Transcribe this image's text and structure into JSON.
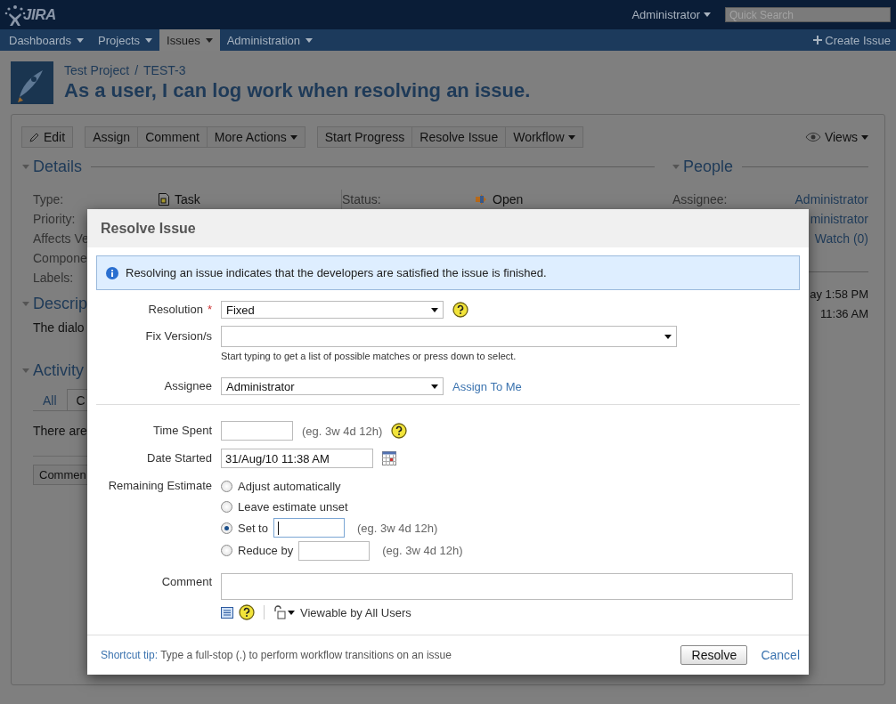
{
  "header": {
    "logo": "JIRA",
    "user": "Administrator",
    "search": {
      "placeholder": "Quick Search"
    }
  },
  "nav": {
    "items": [
      {
        "label": "Dashboards",
        "selected": false
      },
      {
        "label": "Projects",
        "selected": false
      },
      {
        "label": "Issues",
        "selected": true
      },
      {
        "label": "Administration",
        "selected": false
      }
    ],
    "create": "Create Issue"
  },
  "issue": {
    "project": "Test Project",
    "separator": "/",
    "key": "TEST-3",
    "title": "As a user, I can log work when resolving an issue."
  },
  "toolbar": {
    "groups": [
      [
        {
          "label": "Edit",
          "kind": "icon"
        }
      ],
      [
        {
          "label": "Assign",
          "kind": "plain"
        },
        {
          "label": "Comment",
          "kind": "plain"
        },
        {
          "label": "More Actions",
          "kind": "menu"
        }
      ],
      [
        {
          "label": "Start Progress",
          "kind": "plain"
        },
        {
          "label": "Resolve Issue",
          "kind": "plain"
        },
        {
          "label": "Workflow",
          "kind": "menu"
        }
      ]
    ],
    "views": "Views"
  },
  "details": {
    "heading": "Details",
    "rows": [
      {
        "label": "Type:",
        "value": "Task",
        "status_label": "Status:",
        "status_value": "Open"
      },
      {
        "label": "Priority:"
      },
      {
        "label": "Affects Ve"
      },
      {
        "label": "Compone"
      },
      {
        "label": "Labels:"
      }
    ]
  },
  "description": {
    "heading": "Descrip",
    "text": "The dialo"
  },
  "activity": {
    "heading": "Activity",
    "tabs": [
      {
        "label": "All",
        "selected": false
      },
      {
        "label": "C",
        "selected": true
      }
    ],
    "text": "There are",
    "button": "Commen"
  },
  "people": {
    "heading": "People",
    "label": "Assignee:",
    "values": [
      "Administrator",
      "ministrator",
      "Watch (0)"
    ]
  },
  "dates": [
    "ay 1:58 PM",
    "11:36 AM"
  ],
  "dialog": {
    "title": "Resolve Issue",
    "info": "Resolving an issue indicates that the developers are satisfied the issue is finished.",
    "fields": [
      {
        "kind": "select",
        "label": "Resolution",
        "required_mark": "*",
        "value": "Fixed",
        "help": true
      },
      {
        "kind": "picker",
        "label": "Fix Version/s",
        "hint": "Start typing to get a list of possible matches or press down to select."
      },
      {
        "kind": "select",
        "label": "Assignee",
        "value": "Administrator",
        "link": "Assign To Me",
        "help": false
      },
      {
        "kind": "divider"
      },
      {
        "kind": "duration",
        "label": "Time Spent",
        "hint": "(eg. 3w 4d 12h)",
        "help": true
      },
      {
        "kind": "date",
        "label": "Date Started",
        "value": "31/Aug/10 11:38 AM"
      },
      {
        "kind": "radios",
        "label": "Remaining Estimate",
        "options": [
          {
            "label": "Adjust automatically",
            "selected": false
          },
          {
            "label": "Leave estimate unset",
            "selected": false
          },
          {
            "label": "Set to",
            "selected": true,
            "input": {
              "focused": true
            },
            "hint": "(eg. 3w 4d 12h)"
          },
          {
            "label": "Reduce by",
            "selected": false,
            "input": {
              "focused": false
            },
            "hint": "(eg. 3w 4d 12h)"
          }
        ]
      },
      {
        "kind": "comment",
        "label": "Comment",
        "visibility": "Viewable by All Users"
      }
    ],
    "footer": {
      "tip_label": "Shortcut tip:",
      "tip": "Type a full-stop (.) to perform workflow transitions on an issue",
      "submit": "Resolve",
      "cancel": "Cancel"
    }
  }
}
